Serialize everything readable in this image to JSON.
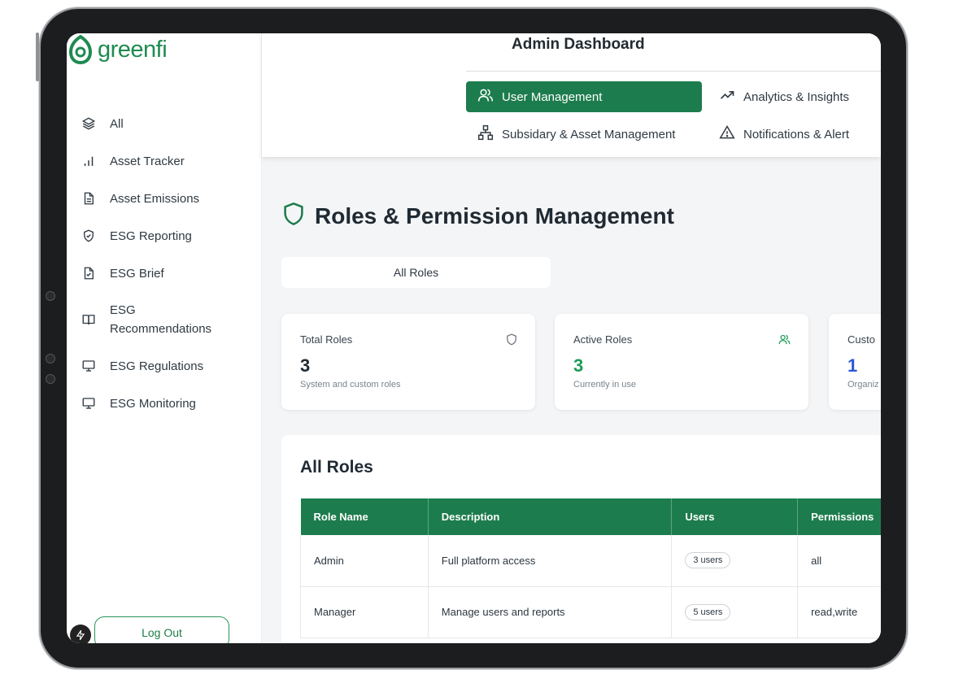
{
  "brand": {
    "name": "greenfi",
    "color": "#1e8b50"
  },
  "sidebar": {
    "items": [
      {
        "label": "All",
        "icon": "layers-icon"
      },
      {
        "label": "Asset Tracker",
        "icon": "bar-chart-icon"
      },
      {
        "label": "Asset Emissions",
        "icon": "document-icon"
      },
      {
        "label": "ESG Reporting",
        "icon": "shield-check-icon"
      },
      {
        "label": "ESG Brief",
        "icon": "file-check-icon"
      },
      {
        "label": "ESG Recommendations",
        "icon": "book-open-icon"
      },
      {
        "label": "ESG Regulations",
        "icon": "monitor-icon"
      },
      {
        "label": "ESG Monitoring",
        "icon": "monitor-icon"
      }
    ],
    "logout_label": "Log Out"
  },
  "header": {
    "title": "Admin Dashboard",
    "tabs": [
      {
        "label": "User Management",
        "icon": "users-icon",
        "active": true
      },
      {
        "label": "Analytics & Insights",
        "icon": "trending-up-icon",
        "active": false
      },
      {
        "label": "Subsidary & Asset Management",
        "icon": "org-chart-icon",
        "active": false
      },
      {
        "label": "Notifications & Alert",
        "icon": "alert-triangle-icon",
        "active": false
      }
    ]
  },
  "main": {
    "page_title": "Roles & Permission Management",
    "roles_tab_label": "All Roles",
    "cards": [
      {
        "label": "Total Roles",
        "value": "3",
        "sub": "System and custom roles",
        "icon": "shield-icon",
        "value_color": "#1f2a33"
      },
      {
        "label": "Active Roles",
        "value": "3",
        "sub": "Currently in use",
        "icon": "users-icon",
        "value_color": "#1f9a58"
      },
      {
        "label": "Custo",
        "value": "1",
        "sub": "Organiz",
        "icon": "",
        "value_color": "#2a59d6"
      }
    ],
    "table": {
      "title": "All Roles",
      "columns": [
        "Role Name",
        "Description",
        "Users",
        "Permissions"
      ],
      "rows": [
        {
          "role": "Admin",
          "description": "Full platform access",
          "users": "3 users",
          "permissions": "all"
        },
        {
          "role": "Manager",
          "description": "Manage users and reports",
          "users": "5 users",
          "permissions": "read,write"
        }
      ]
    }
  },
  "colors": {
    "accent": "#1d7c4d",
    "background": "#f4f5f6"
  }
}
